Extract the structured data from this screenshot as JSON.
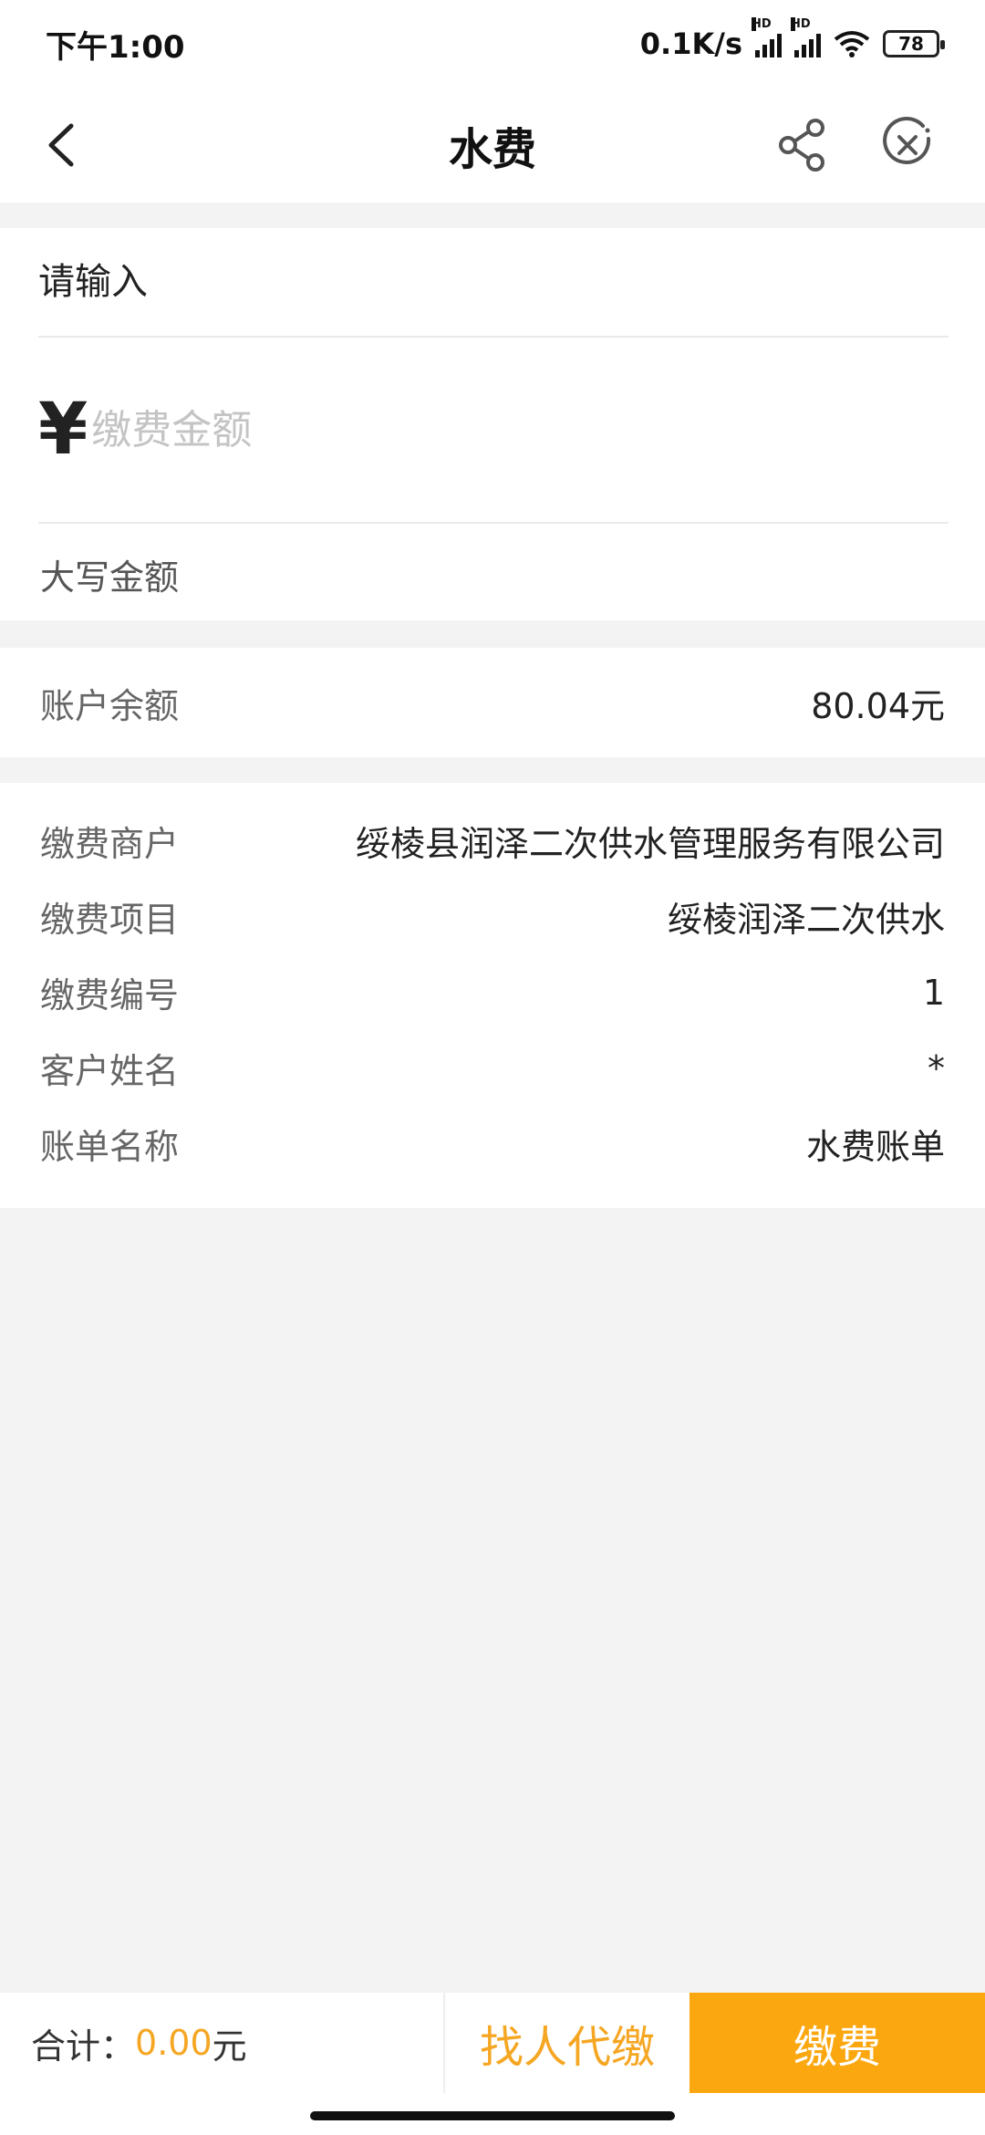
{
  "status_bar": {
    "time": "下午1:00",
    "network_speed": "0.1K/s",
    "signal_badge_1": "HD",
    "signal_badge_2": "HD",
    "battery": "78"
  },
  "nav": {
    "title": "水费",
    "back_icon": "chevron-left-icon",
    "share_icon": "share-icon",
    "close_icon": "close-circle-icon"
  },
  "form": {
    "account_placeholder": "请输入",
    "currency_symbol": "¥",
    "amount_placeholder": "缴费金额",
    "capital_label": "大写金额"
  },
  "balance": {
    "label": "账户余额",
    "value": "80.04元"
  },
  "info": {
    "rows": [
      {
        "label": "缴费商户",
        "value": "绥棱县润泽二次供水管理服务有限公司"
      },
      {
        "label": "缴费项目",
        "value": "绥棱润泽二次供水"
      },
      {
        "label": "缴费编号",
        "value": "1"
      },
      {
        "label": "客户姓名",
        "value": "*"
      },
      {
        "label": "账单名称",
        "value": "水费账单"
      }
    ]
  },
  "footer": {
    "total_label": "合计：",
    "total_amount": "0.00",
    "total_unit": "元",
    "proxy_button": "找人代缴",
    "pay_button": "缴费"
  },
  "colors": {
    "accent": "#fba710",
    "accent_text": "#f5a623",
    "background": "#f3f3f3"
  }
}
